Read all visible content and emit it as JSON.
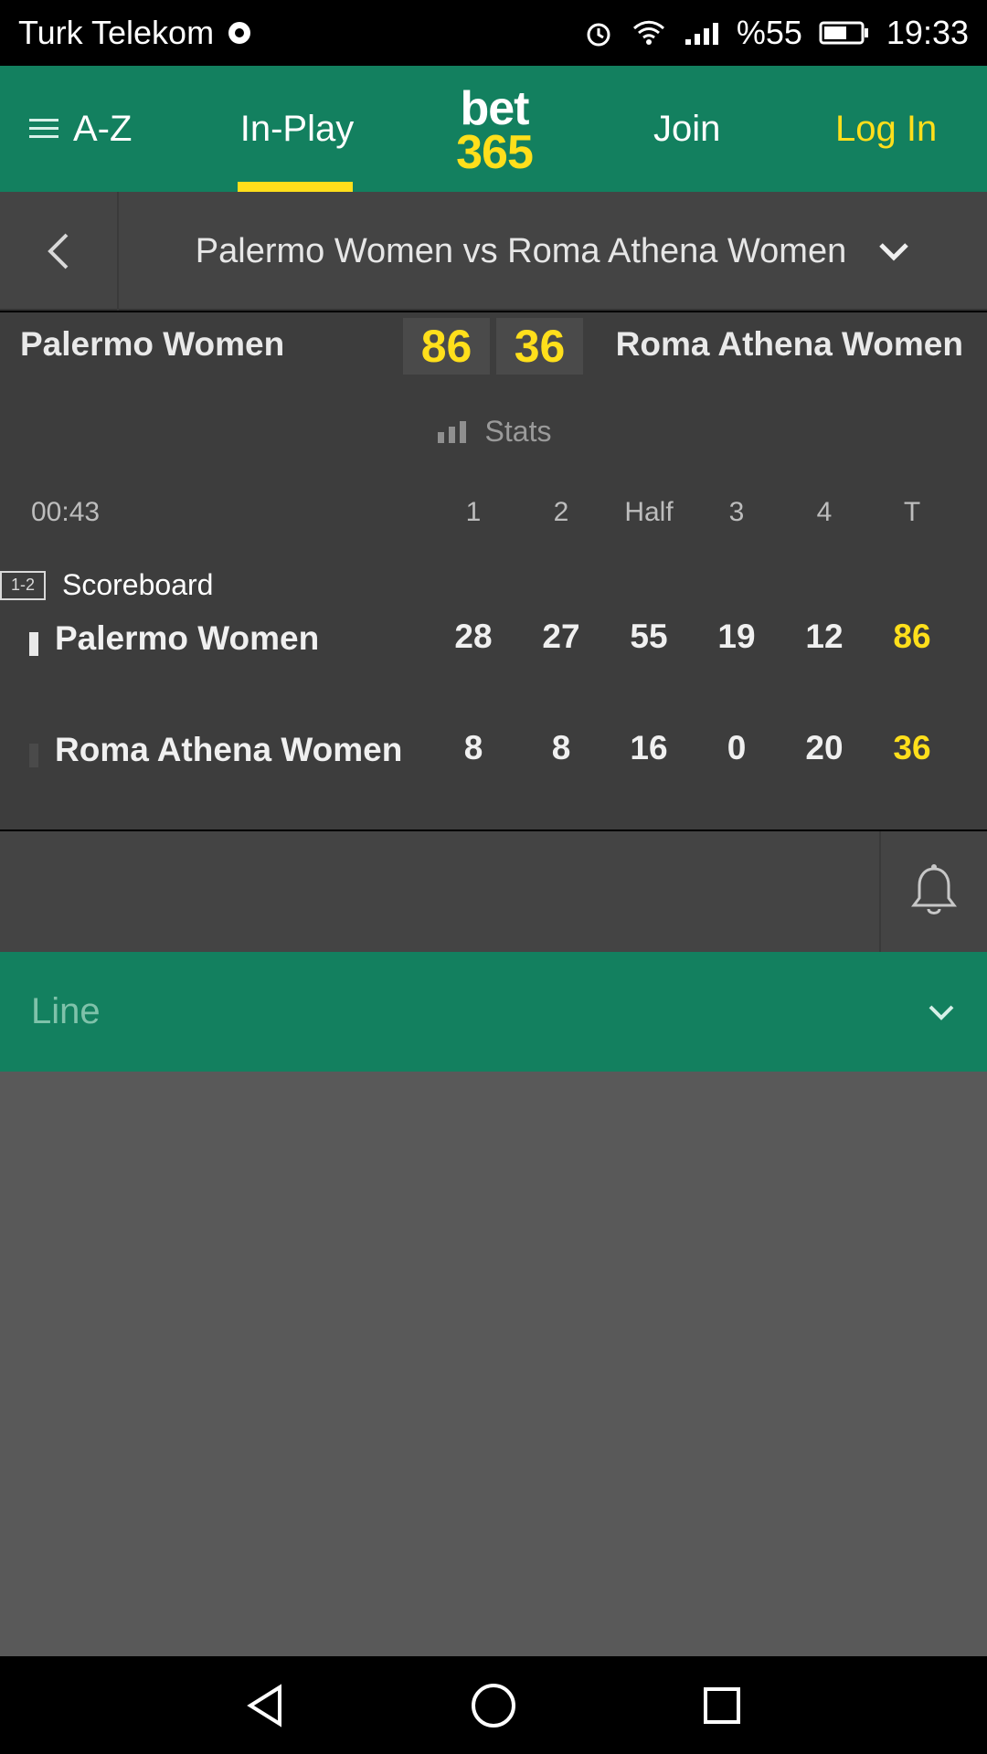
{
  "status_bar": {
    "carrier": "Turk Telekom",
    "battery": "%55",
    "time": "19:33",
    "icons": [
      "chrome-icon",
      "alarm-icon",
      "wifi-icon",
      "signal-icon",
      "battery-icon"
    ]
  },
  "nav": {
    "az_label": "A-Z",
    "inplay_label": "In-Play",
    "brand_top": "bet",
    "brand_bottom": "365",
    "join_label": "Join",
    "login_label": "Log In"
  },
  "match": {
    "title": "Palermo Women vs Roma Athena Women",
    "team_home": "Palermo Women",
    "team_away": "Roma Athena Women",
    "score_home": "86",
    "score_away": "36",
    "tabs": {
      "stats": "Stats",
      "scoreboard": "Scoreboard",
      "scoreboard_badge": "1-2"
    }
  },
  "scoreboard": {
    "time": "00:43",
    "columns": [
      "1",
      "2",
      "Half",
      "3",
      "4",
      "T"
    ],
    "rows": [
      {
        "team": "Palermo Women",
        "values": [
          "28",
          "27",
          "55",
          "19",
          "12",
          "86"
        ],
        "active": true
      },
      {
        "team": "Roma Athena Women",
        "values": [
          "8",
          "8",
          "16",
          "0",
          "20",
          "36"
        ],
        "active": false
      }
    ]
  },
  "markets": {
    "line_label": "Line"
  },
  "colors": {
    "green": "#13805f",
    "yellow": "#ffdf1b",
    "dark": "#3b3b3b",
    "grey": "#595959"
  }
}
